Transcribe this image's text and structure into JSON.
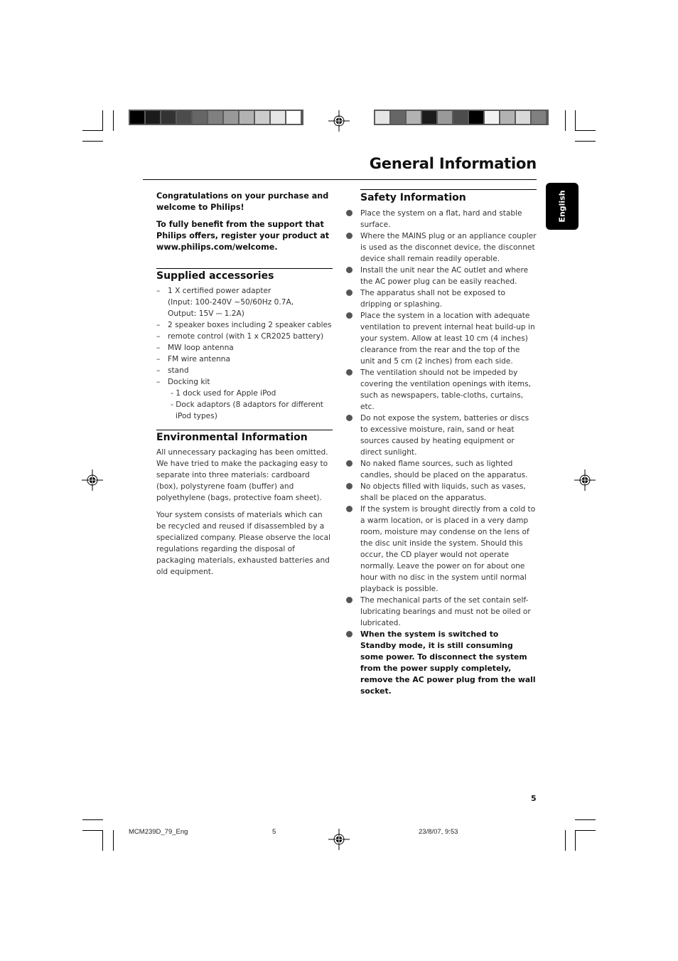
{
  "colors": {
    "left_bar": [
      "#000000",
      "#1b1b1b",
      "#333333",
      "#4c4c4c",
      "#666666",
      "#808080",
      "#999999",
      "#b2b2b2",
      "#cccccc",
      "#e5e5e5",
      "#ffffff"
    ],
    "right_bar": [
      "#e5e5e5",
      "#666666",
      "#b2b2b2",
      "#1b1b1b",
      "#999999",
      "#4c4c4c",
      "#000000",
      "#f2f2f2",
      "#b2b2b2",
      "#d9d9d9",
      "#808080"
    ],
    "language_tab_bg": "#000000",
    "bullet": "#555555"
  },
  "header": {
    "title": "General Information"
  },
  "language_tab": "English",
  "intro": {
    "greeting": "Congratulations on your purchase and welcome to Philips!",
    "register": "To fully benefit from the support that Philips offers, register your product at www.philips.com/welcome."
  },
  "supplied_accessories": {
    "heading": "Supplied accessories",
    "items": [
      {
        "lines": [
          "1 X certified power adapter",
          "(Input: 100-240V ~50/60Hz 0.7A,",
          "Output: 15V ⎓ 1.2A)"
        ]
      },
      {
        "lines": [
          "2 speaker boxes including 2 speaker cables"
        ]
      },
      {
        "lines": [
          "remote control (with 1 x CR2025 battery)"
        ]
      },
      {
        "lines": [
          "MW loop antenna"
        ]
      },
      {
        "lines": [
          "FM wire antenna"
        ]
      },
      {
        "lines": [
          "stand"
        ]
      },
      {
        "lines": [
          "Docking kit"
        ]
      }
    ],
    "docking_sub": [
      "- 1 dock used for Apple iPod",
      "- Dock adaptors (8 adaptors for different",
      "iPod types)"
    ]
  },
  "environmental": {
    "heading": "Environmental Information",
    "paragraphs": [
      "All unnecessary packaging has been omitted. We have tried to make the packaging easy to separate into three materials: cardboard (box), polystyrene foam (buffer) and polyethylene (bags, protective foam sheet).",
      "Your system consists of materials which can be recycled and reused if disassembled by a specialized company. Please observe the local regulations regarding the disposal of packaging materials, exhausted batteries and old equipment."
    ]
  },
  "safety": {
    "heading": "Safety Information",
    "items": [
      "Place the system on a flat, hard and stable surface.",
      "Where the MAINS plug or an appliance coupler is used as the disconnet device, the disconnet device shall remain readily operable.",
      "Install the unit near the AC outlet and where the AC power plug can be easily reached.",
      "The apparatus shall not be exposed to dripping or splashing.",
      "Place the system in a location with adequate ventilation to prevent internal heat build-up in your system.  Allow at least 10 cm (4 inches) clearance from the rear and the top of the unit and 5 cm (2 inches) from each side.",
      "The ventilation should not be impeded by covering the ventilation openings with items, such as newspapers, table-cloths, curtains, etc.",
      "Do not expose the system, batteries or discs to excessive moisture, rain, sand or heat sources caused by heating equipment or direct sunlight.",
      "No naked flame sources, such as lighted candles, should be placed on the apparatus.",
      "No objects filled with liquids, such as vases, shall be placed on the apparatus.",
      "If the system is brought directly from a cold to a warm location, or is placed in a very damp room, moisture may condense on the lens of the disc unit inside the system. Should this occur, the CD player would not operate normally. Leave the power on for about one hour with no disc in the system until normal playback is possible.",
      "The mechanical parts of the set contain self-lubricating bearings and must not be oiled or lubricated."
    ],
    "bold_item": "When the system is switched to Standby mode, it is still consuming some power. To disconnect the system from the power supply completely, remove the AC power plug from the wall socket."
  },
  "page_number": "5",
  "footer": {
    "file": "MCM239D_79_Eng",
    "page": "5",
    "datetime": "23/8/07, 9:53"
  }
}
